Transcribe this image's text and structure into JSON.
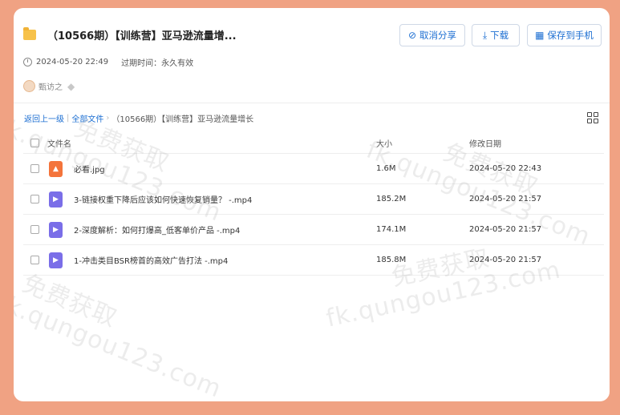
{
  "header": {
    "title": "（10566期）【训练营】亚马逊流量增...",
    "buttons": {
      "cancel_share": "取消分享",
      "download": "下载",
      "save_to_phone": "保存到手机"
    }
  },
  "meta": {
    "date": "2024-05-20 22:49",
    "expire_label": "过期时间：",
    "expire_value": "永久有效"
  },
  "user": {
    "name": "甄访之"
  },
  "breadcrumb": {
    "back": "返回上一级",
    "all_files": "全部文件",
    "current": "（10566期）【训练营】亚马逊流量增长"
  },
  "table": {
    "headers": {
      "name": "文件名",
      "size": "大小",
      "date": "修改日期"
    },
    "rows": [
      {
        "name": "必看.jpg",
        "size": "1.6M",
        "date": "2024-05-20 22:43",
        "type": "image"
      },
      {
        "name": "3-链接权重下降后应该如何快速恢复销量？ -.mp4",
        "size": "185.2M",
        "date": "2024-05-20 21:57",
        "type": "video"
      },
      {
        "name": "2-深度解析：如何打爆高_低客单价产品 -.mp4",
        "size": "174.1M",
        "date": "2024-05-20 21:57",
        "type": "video"
      },
      {
        "name": "1-冲击类目BSR榜首的高效广告打法 -.mp4",
        "size": "185.8M",
        "date": "2024-05-20 21:57",
        "type": "video"
      }
    ]
  },
  "watermark": {
    "line1": "免费获取",
    "line2": "fk.qungou123.com"
  },
  "colors": {
    "background": "#f0a283",
    "link": "#1d6fd2",
    "image_icon": "#f4743b",
    "video_icon": "#7a6ee8"
  }
}
